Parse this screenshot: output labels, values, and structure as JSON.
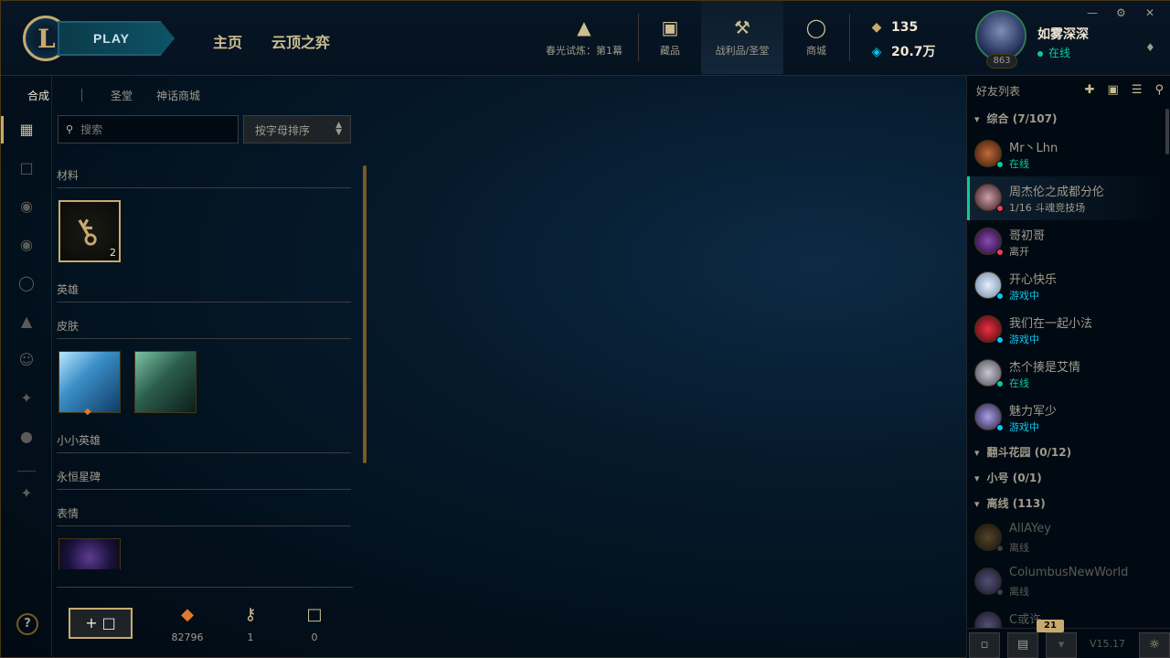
{
  "nav": {
    "play_label": "PLAY",
    "home": "主页",
    "tft": "云顶之弈",
    "items": [
      {
        "label": "春光试炼：第1幕",
        "icon": "pass-icon"
      },
      {
        "label": "藏品",
        "icon": "collection-icon"
      },
      {
        "label": "战利品/圣堂",
        "icon": "loot-icon"
      },
      {
        "label": "商城",
        "icon": "store-icon"
      }
    ],
    "currency_rp": "135",
    "currency_be": "20.7万"
  },
  "profile": {
    "name": "如雾深深",
    "status": "在线",
    "level": "863"
  },
  "subtabs": [
    "合成",
    "圣堂",
    "神话商城"
  ],
  "search": {
    "placeholder": "搜索"
  },
  "sort": {
    "value": "按字母排序"
  },
  "sections": {
    "materials": "材料",
    "champions": "英雄",
    "skins": "皮肤",
    "little_legends": "小小英雄",
    "eternals": "永恒星碑",
    "emotes": "表情"
  },
  "key_count": "2",
  "bottom": {
    "craft_label": "+",
    "orange_essence": "82796",
    "keys": "1",
    "chests": "0"
  },
  "friends": {
    "title": "好友列表",
    "group_general": "综合 (7/107)",
    "group_garden": "翻斗花园 (0/12)",
    "group_alt": "小号 (0/1)",
    "group_offline": "离线 (113)",
    "list": [
      {
        "name": "Mr丶Lhn",
        "status": "在线"
      },
      {
        "name": "周杰伦之成都分伦",
        "status": "1/16 斗魂竞技场"
      },
      {
        "name": "哥初哥",
        "status": "离开"
      },
      {
        "name": "开心快乐",
        "status": "游戏中"
      },
      {
        "name": "我们在一起小法",
        "status": "游戏中"
      },
      {
        "name": "杰个揍是艾情",
        "status": "在线"
      },
      {
        "name": "魅力军少",
        "status": "游戏中"
      }
    ],
    "offline": [
      {
        "name": "AllAYey",
        "status": "离线"
      },
      {
        "name": "ColumbusNewWorld",
        "status": "离线"
      },
      {
        "name": "C或许",
        "status": ""
      }
    ],
    "notif_count": "21",
    "version": "V15.17"
  }
}
